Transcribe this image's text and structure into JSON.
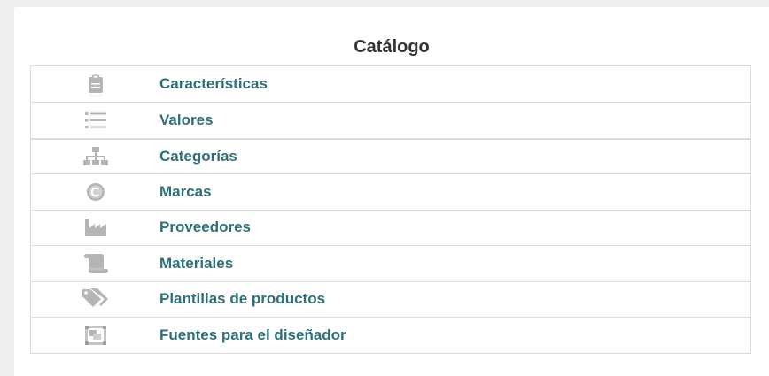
{
  "catalog": {
    "title": "Catálogo",
    "items": [
      {
        "label": "Características",
        "icon": "clipboard-icon"
      },
      {
        "label": "Valores",
        "icon": "list-icon"
      },
      {
        "label": "Categorías",
        "icon": "sitemap-icon"
      },
      {
        "label": "Marcas",
        "icon": "copyright-icon"
      },
      {
        "label": "Proveedores",
        "icon": "factory-icon"
      },
      {
        "label": "Materiales",
        "icon": "scroll-icon"
      },
      {
        "label": "Plantillas de productos",
        "icon": "tags-icon"
      },
      {
        "label": "Fuentes para el diseñador",
        "icon": "object-group-icon"
      }
    ]
  },
  "colors": {
    "link": "#2f6f77",
    "icon": "#b5b5b5",
    "border": "#dcdcdc",
    "background": "#efefef"
  }
}
